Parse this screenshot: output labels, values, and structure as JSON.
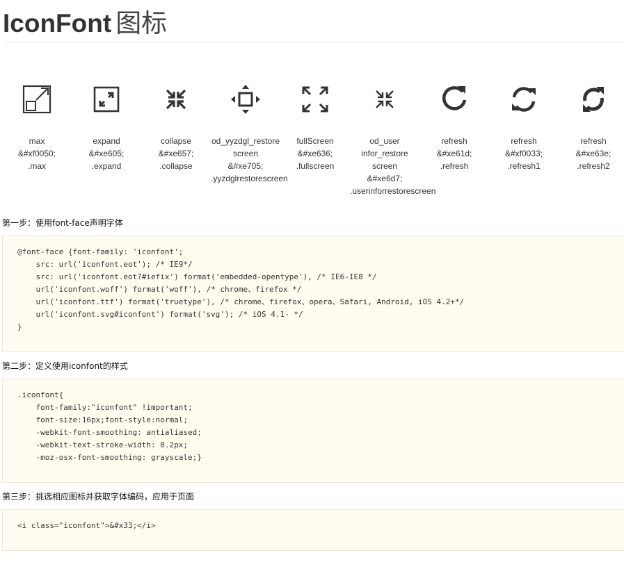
{
  "page": {
    "title_en": "IconFont",
    "title_zh": "图标"
  },
  "icons": [
    {
      "icon": "max-icon",
      "lines": [
        "max",
        "&#xf0050;",
        ".max"
      ]
    },
    {
      "icon": "expand-icon",
      "lines": [
        "expand",
        "&#xe605;",
        ".expand"
      ]
    },
    {
      "icon": "collapse-icon",
      "lines": [
        "collapse",
        "&#xe657;",
        ".collapse"
      ]
    },
    {
      "icon": "restore-screen-icon",
      "lines": [
        "od_yyzdgl_restore",
        "screen",
        "&#xe705;",
        ".yyzdglrestorescreen"
      ]
    },
    {
      "icon": "fullscreen-icon",
      "lines": [
        "fullScreen",
        "&#xe636;",
        ".fullscreen"
      ]
    },
    {
      "icon": "user-restore-screen-icon",
      "lines": [
        "od_user",
        "infor_restore",
        "screen",
        "&#xe6d7;",
        ".userinforrestorescreen"
      ]
    },
    {
      "icon": "refresh-icon",
      "lines": [
        "refresh",
        "&#xe61d;",
        ".refresh"
      ]
    },
    {
      "icon": "refresh1-icon",
      "lines": [
        "refresh",
        "&#xf0033;",
        ".refresh1"
      ]
    },
    {
      "icon": "refresh2-icon",
      "lines": [
        "refresh",
        "&#xe63e;",
        ".refresh2"
      ]
    }
  ],
  "steps": [
    {
      "title": "第一步：使用font-face声明字体",
      "code": [
        "@font-face {font-family: 'iconfont';",
        "    src: url('iconfont.eot'); /* IE9*/",
        "    src: url('iconfont.eot?#iefix') format('embedded-opentype'), /* IE6-IE8 */",
        "    url('iconfont.woff') format('woff'), /* chrome、firefox */",
        "    url('iconfont.ttf') format('truetype'), /* chrome、firefox、opera、Safari, Android, iOS 4.2+*/",
        "    url('iconfont.svg#iconfont') format('svg'); /* iOS 4.1- */",
        "}"
      ]
    },
    {
      "title": "第二步：定义使用iconfont的样式",
      "code": [
        ".iconfont{",
        "    font-family:\"iconfont\" !important;",
        "    font-size:16px;font-style:normal;",
        "    -webkit-font-smoothing: antialiased;",
        "    -webkit-text-stroke-width: 0.2px;",
        "    -moz-osx-font-smoothing: grayscale;}"
      ]
    },
    {
      "title": "第三步：挑选相应图标并获取字体编码，应用于页面",
      "code": [
        "<i class=\"iconfont\">&#x33;</i>"
      ]
    }
  ]
}
